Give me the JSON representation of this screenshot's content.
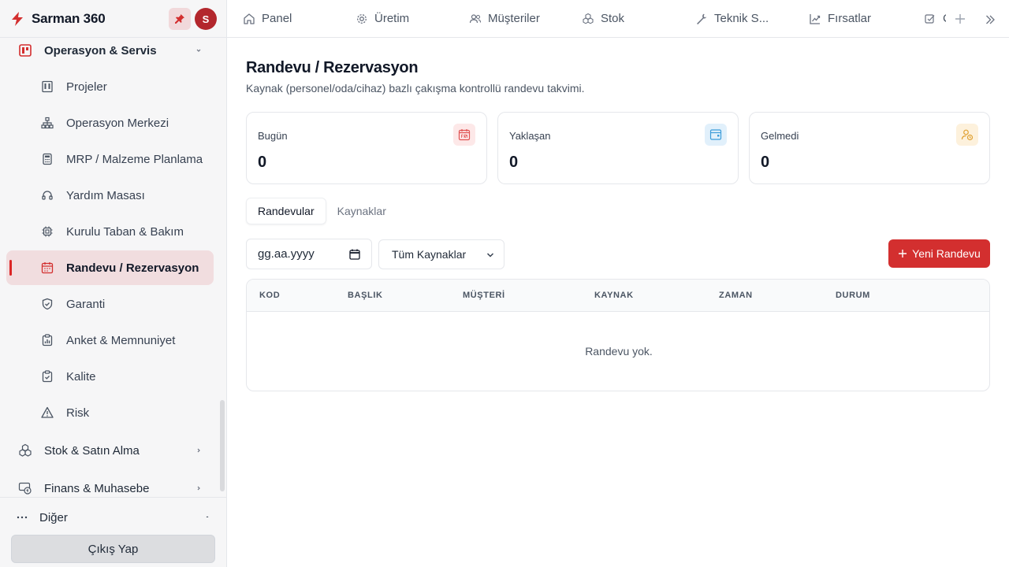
{
  "brand": {
    "title": "Sarman 360",
    "avatar_initial": "S"
  },
  "sidebar": {
    "group_current": "Operasyon & Servis",
    "items": [
      {
        "label": "Projeler",
        "icon": "building-icon"
      },
      {
        "label": "Operasyon Merkezi",
        "icon": "org-chart-icon"
      },
      {
        "label": "MRP / Malzeme Planlama",
        "icon": "calculator-icon"
      },
      {
        "label": "Yardım Masası",
        "icon": "headset-icon"
      },
      {
        "label": "Kurulu Taban & Bakım",
        "icon": "chip-icon"
      },
      {
        "label": "Randevu / Rezervasyon",
        "icon": "calendar-icon",
        "active": true
      },
      {
        "label": "Garanti",
        "icon": "shield-check-icon"
      },
      {
        "label": "Anket & Memnuniyet",
        "icon": "clipboard-chart-icon"
      },
      {
        "label": "Kalite",
        "icon": "clipboard-check-icon"
      },
      {
        "label": "Risk",
        "icon": "warning-icon"
      }
    ],
    "group_stock": "Stok & Satın Alma",
    "group_finance": "Finans & Muhasebe",
    "other": "Diğer",
    "logout": "Çıkış Yap"
  },
  "topbar": {
    "tabs": [
      {
        "label": "Panel",
        "icon": "home-icon"
      },
      {
        "label": "Üretim",
        "icon": "gear-icon"
      },
      {
        "label": "Müşteriler",
        "icon": "users-icon"
      },
      {
        "label": "Stok",
        "icon": "boxes-icon"
      },
      {
        "label": "Teknik S...",
        "icon": "wrench-icon"
      },
      {
        "label": "Fırsatlar",
        "icon": "trend-icon"
      },
      {
        "label": "C",
        "icon": "checkbox-icon"
      }
    ]
  },
  "page": {
    "title": "Randevu / Rezervasyon",
    "subtitle": "Kaynak (personel/oda/cihaz) bazlı çakışma kontrollü randevu takvimi."
  },
  "stats": [
    {
      "label": "Bugün",
      "value": "0",
      "color": "#e05252",
      "bg": "#fde8e8"
    },
    {
      "label": "Yaklaşan",
      "value": "0",
      "color": "#3b9bd9",
      "bg": "#e1f0fb"
    },
    {
      "label": "Gelmedi",
      "value": "0",
      "color": "#e0a030",
      "bg": "#fdf1dc"
    }
  ],
  "tabs": {
    "appointments": "Randevular",
    "resources": "Kaynaklar"
  },
  "filters": {
    "date_placeholder": "gg.aa.yyyy",
    "resource_select": "Tüm Kaynaklar"
  },
  "new_button": "Yeni Randevu",
  "table": {
    "columns": [
      "KOD",
      "BAŞLIK",
      "MÜŞTERİ",
      "KAYNAK",
      "ZAMAN",
      "DURUM"
    ],
    "empty": "Randevu yok."
  },
  "colors": {
    "accent": "#d32f2f",
    "active_bg": "#f1dddf"
  }
}
